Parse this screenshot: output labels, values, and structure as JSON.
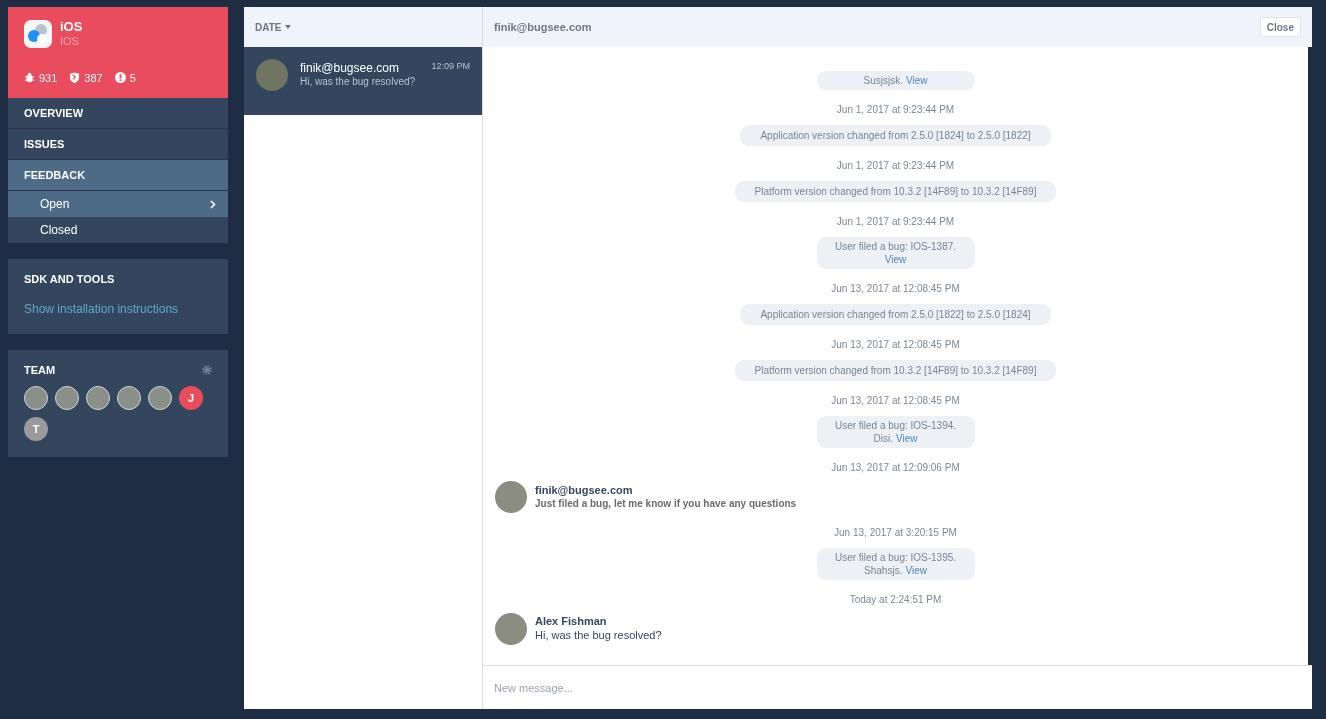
{
  "project": {
    "name": "iOS",
    "platform": "IOS",
    "stats": [
      {
        "kind": "bugs",
        "value": "931"
      },
      {
        "kind": "crashes",
        "value": "387"
      },
      {
        "kind": "errors",
        "value": "5"
      }
    ]
  },
  "nav": [
    {
      "label": "OVERVIEW",
      "selected": false
    },
    {
      "label": "ISSUES",
      "selected": false
    },
    {
      "label": "FEEDBACK",
      "selected": true,
      "children": [
        {
          "label": "Open",
          "selected": true
        },
        {
          "label": "Closed",
          "selected": false
        }
      ]
    }
  ],
  "sdk": {
    "title": "SDK AND TOOLS",
    "link": "Show installation instructions"
  },
  "team": {
    "title": "TEAM",
    "members": [
      {
        "kind": "photo"
      },
      {
        "kind": "photo"
      },
      {
        "kind": "photo"
      },
      {
        "kind": "photo"
      },
      {
        "kind": "photo"
      },
      {
        "kind": "letter",
        "letter": "J",
        "color": "#e94c5d"
      },
      {
        "kind": "letter",
        "letter": "T",
        "color": "#9a9a9a"
      }
    ]
  },
  "list": {
    "sort_label": "DATE",
    "items": [
      {
        "from": "finik@bugsee.com",
        "preview": "Hi, was the bug resolved?",
        "time": "12:09 PM",
        "selected": true
      }
    ]
  },
  "chat": {
    "title": "finik@bugsee.com",
    "close": "Close",
    "placeholder": "New message...",
    "feed": [
      {
        "kind": "bug",
        "detail": "Susjsjsk.",
        "link": "View"
      },
      {
        "kind": "time",
        "text": "Jun 1, 2017 at 9:23:44 PM"
      },
      {
        "kind": "event",
        "text": "Application version changed from 2.5.0 [1824] to 2.5.0 [1822]"
      },
      {
        "kind": "time",
        "text": "Jun 1, 2017 at 9:23:44 PM"
      },
      {
        "kind": "event",
        "text": "Platform version changed from 10.3.2 [14F89] to 10.3.2 [14F89]"
      },
      {
        "kind": "time",
        "text": "Jun 1, 2017 at 9:23:44 PM"
      },
      {
        "kind": "bug",
        "text": "User filed a bug: IOS-1387.",
        "link": "View"
      },
      {
        "kind": "time",
        "text": "Jun 13, 2017 at 12:08:45 PM"
      },
      {
        "kind": "event",
        "text": "Application version changed from 2.5.0 [1822] to 2.5.0 [1824]"
      },
      {
        "kind": "time",
        "text": "Jun 13, 2017 at 12:08:45 PM"
      },
      {
        "kind": "event",
        "text": "Platform version changed from 10.3.2 [14F89] to 10.3.2 [14F89]"
      },
      {
        "kind": "time",
        "text": "Jun 13, 2017 at 12:08:45 PM"
      },
      {
        "kind": "bug",
        "text": "User filed a bug: IOS-1394.",
        "detail": "Disi.",
        "link": "View"
      },
      {
        "kind": "time",
        "text": "Jun 13, 2017 at 12:09:06 PM"
      },
      {
        "kind": "message",
        "author": "finik@bugsee.com",
        "text": "Just filed a bug, let me know if you have any questions",
        "bold": true
      },
      {
        "kind": "time",
        "text": "Jun 13, 2017 at 3:20:15 PM"
      },
      {
        "kind": "bug",
        "text": "User filed a bug: IOS-1395.",
        "detail": "Shahsjs.",
        "link": "View"
      },
      {
        "kind": "time",
        "text": "Today at 2:24:51 PM"
      },
      {
        "kind": "message",
        "author": "Alex Fishman",
        "text": "Hi, was the bug resolved?",
        "bold": false
      }
    ]
  }
}
